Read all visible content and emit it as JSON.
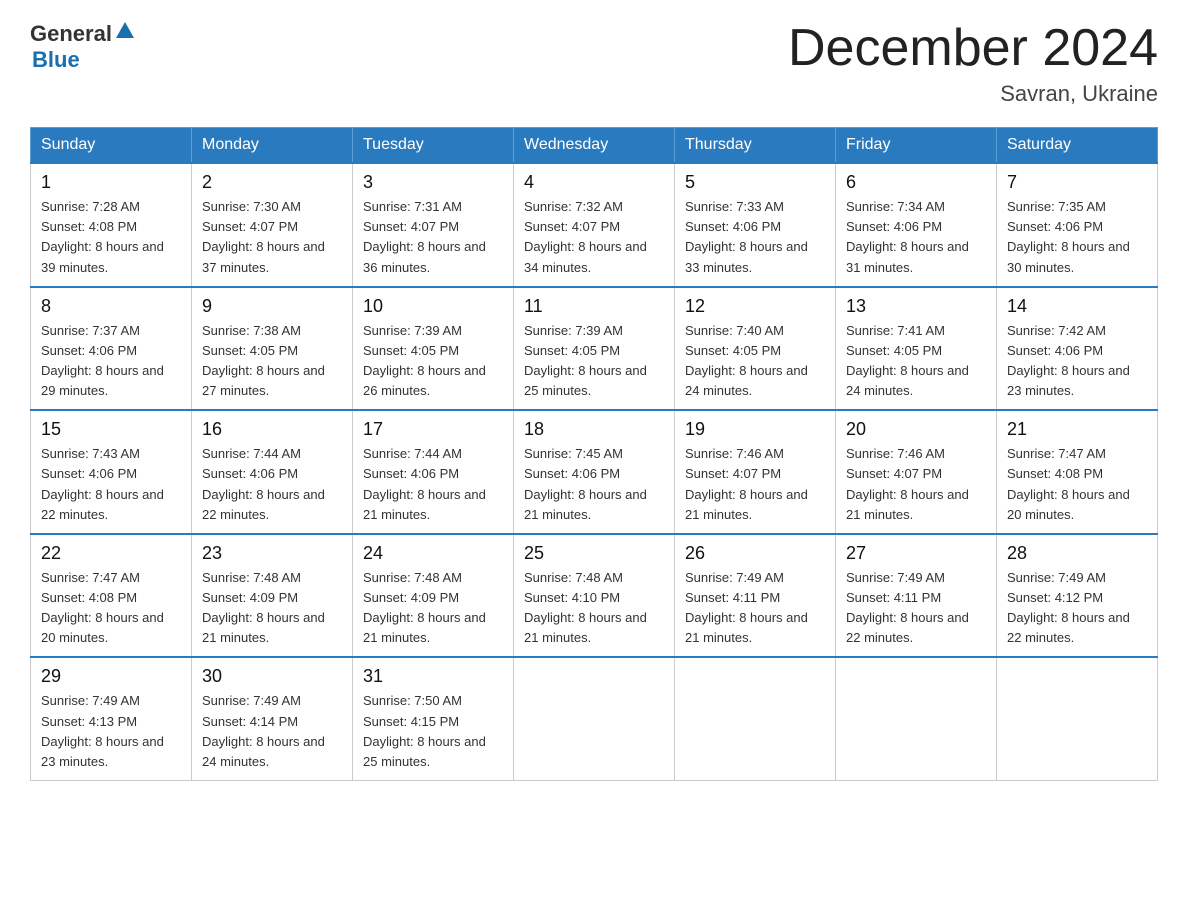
{
  "header": {
    "logo_general": "General",
    "logo_blue": "Blue",
    "month_title": "December 2024",
    "subtitle": "Savran, Ukraine"
  },
  "days_of_week": [
    "Sunday",
    "Monday",
    "Tuesday",
    "Wednesday",
    "Thursday",
    "Friday",
    "Saturday"
  ],
  "weeks": [
    [
      {
        "day": "1",
        "sunrise": "7:28 AM",
        "sunset": "4:08 PM",
        "daylight": "8 hours and 39 minutes."
      },
      {
        "day": "2",
        "sunrise": "7:30 AM",
        "sunset": "4:07 PM",
        "daylight": "8 hours and 37 minutes."
      },
      {
        "day": "3",
        "sunrise": "7:31 AM",
        "sunset": "4:07 PM",
        "daylight": "8 hours and 36 minutes."
      },
      {
        "day": "4",
        "sunrise": "7:32 AM",
        "sunset": "4:07 PM",
        "daylight": "8 hours and 34 minutes."
      },
      {
        "day": "5",
        "sunrise": "7:33 AM",
        "sunset": "4:06 PM",
        "daylight": "8 hours and 33 minutes."
      },
      {
        "day": "6",
        "sunrise": "7:34 AM",
        "sunset": "4:06 PM",
        "daylight": "8 hours and 31 minutes."
      },
      {
        "day": "7",
        "sunrise": "7:35 AM",
        "sunset": "4:06 PM",
        "daylight": "8 hours and 30 minutes."
      }
    ],
    [
      {
        "day": "8",
        "sunrise": "7:37 AM",
        "sunset": "4:06 PM",
        "daylight": "8 hours and 29 minutes."
      },
      {
        "day": "9",
        "sunrise": "7:38 AM",
        "sunset": "4:05 PM",
        "daylight": "8 hours and 27 minutes."
      },
      {
        "day": "10",
        "sunrise": "7:39 AM",
        "sunset": "4:05 PM",
        "daylight": "8 hours and 26 minutes."
      },
      {
        "day": "11",
        "sunrise": "7:39 AM",
        "sunset": "4:05 PM",
        "daylight": "8 hours and 25 minutes."
      },
      {
        "day": "12",
        "sunrise": "7:40 AM",
        "sunset": "4:05 PM",
        "daylight": "8 hours and 24 minutes."
      },
      {
        "day": "13",
        "sunrise": "7:41 AM",
        "sunset": "4:05 PM",
        "daylight": "8 hours and 24 minutes."
      },
      {
        "day": "14",
        "sunrise": "7:42 AM",
        "sunset": "4:06 PM",
        "daylight": "8 hours and 23 minutes."
      }
    ],
    [
      {
        "day": "15",
        "sunrise": "7:43 AM",
        "sunset": "4:06 PM",
        "daylight": "8 hours and 22 minutes."
      },
      {
        "day": "16",
        "sunrise": "7:44 AM",
        "sunset": "4:06 PM",
        "daylight": "8 hours and 22 minutes."
      },
      {
        "day": "17",
        "sunrise": "7:44 AM",
        "sunset": "4:06 PM",
        "daylight": "8 hours and 21 minutes."
      },
      {
        "day": "18",
        "sunrise": "7:45 AM",
        "sunset": "4:06 PM",
        "daylight": "8 hours and 21 minutes."
      },
      {
        "day": "19",
        "sunrise": "7:46 AM",
        "sunset": "4:07 PM",
        "daylight": "8 hours and 21 minutes."
      },
      {
        "day": "20",
        "sunrise": "7:46 AM",
        "sunset": "4:07 PM",
        "daylight": "8 hours and 21 minutes."
      },
      {
        "day": "21",
        "sunrise": "7:47 AM",
        "sunset": "4:08 PM",
        "daylight": "8 hours and 20 minutes."
      }
    ],
    [
      {
        "day": "22",
        "sunrise": "7:47 AM",
        "sunset": "4:08 PM",
        "daylight": "8 hours and 20 minutes."
      },
      {
        "day": "23",
        "sunrise": "7:48 AM",
        "sunset": "4:09 PM",
        "daylight": "8 hours and 21 minutes."
      },
      {
        "day": "24",
        "sunrise": "7:48 AM",
        "sunset": "4:09 PM",
        "daylight": "8 hours and 21 minutes."
      },
      {
        "day": "25",
        "sunrise": "7:48 AM",
        "sunset": "4:10 PM",
        "daylight": "8 hours and 21 minutes."
      },
      {
        "day": "26",
        "sunrise": "7:49 AM",
        "sunset": "4:11 PM",
        "daylight": "8 hours and 21 minutes."
      },
      {
        "day": "27",
        "sunrise": "7:49 AM",
        "sunset": "4:11 PM",
        "daylight": "8 hours and 22 minutes."
      },
      {
        "day": "28",
        "sunrise": "7:49 AM",
        "sunset": "4:12 PM",
        "daylight": "8 hours and 22 minutes."
      }
    ],
    [
      {
        "day": "29",
        "sunrise": "7:49 AM",
        "sunset": "4:13 PM",
        "daylight": "8 hours and 23 minutes."
      },
      {
        "day": "30",
        "sunrise": "7:49 AM",
        "sunset": "4:14 PM",
        "daylight": "8 hours and 24 minutes."
      },
      {
        "day": "31",
        "sunrise": "7:50 AM",
        "sunset": "4:15 PM",
        "daylight": "8 hours and 25 minutes."
      },
      null,
      null,
      null,
      null
    ]
  ]
}
